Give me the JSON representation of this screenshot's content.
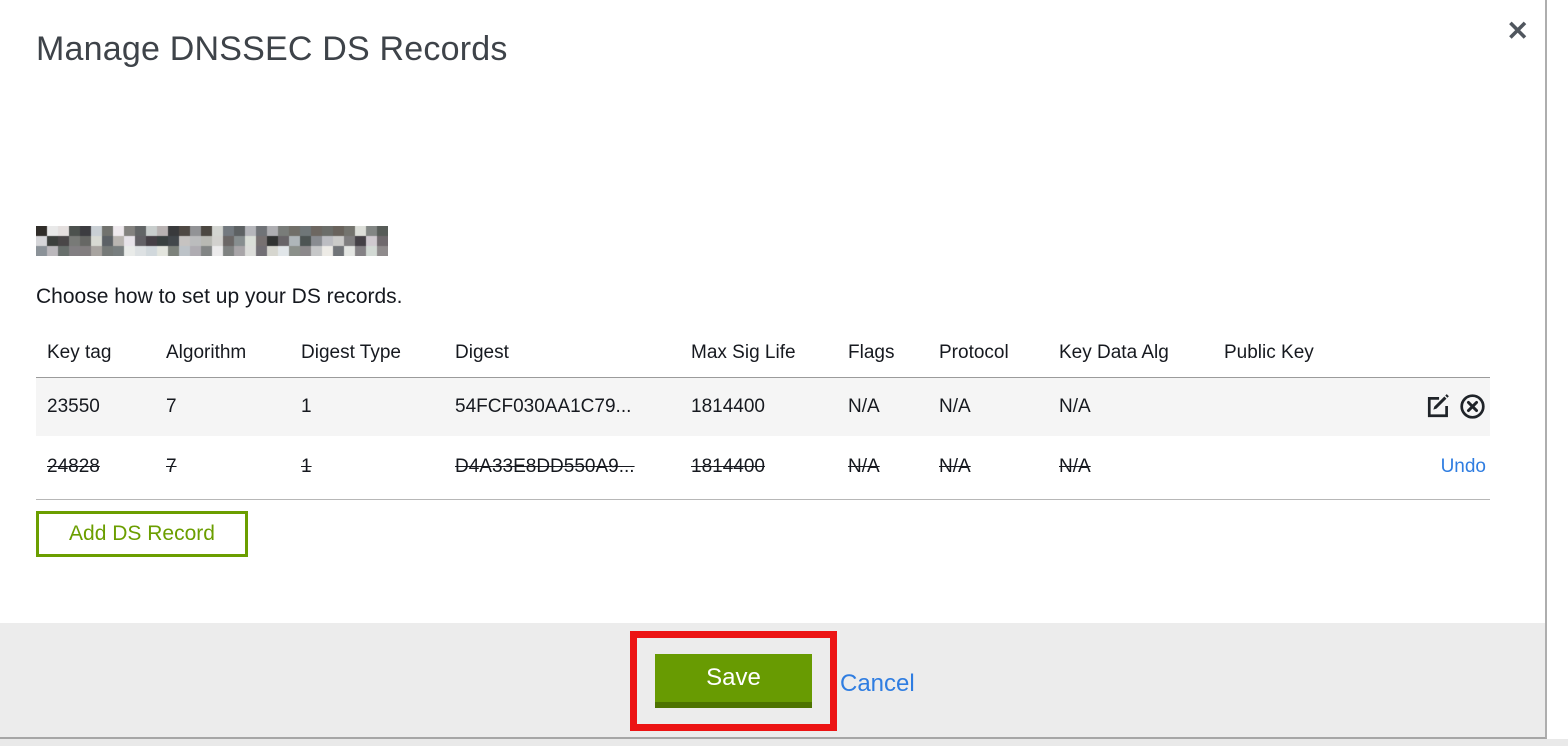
{
  "modal": {
    "title": "Manage DNSSEC DS Records",
    "close_glyph": "✕",
    "instruction": "Choose how to set up your DS records.",
    "add_button_label": "Add DS Record",
    "save_button_label": "Save",
    "cancel_label": "Cancel",
    "undo_label": "Undo"
  },
  "table": {
    "columns": [
      "Key tag",
      "Algorithm",
      "Digest Type",
      "Digest",
      "Max Sig Life",
      "Flags",
      "Protocol",
      "Key Data Alg",
      "Public Key"
    ],
    "rows": [
      {
        "key_tag": "23550",
        "algorithm": "7",
        "digest_type": "1",
        "digest": "54FCF030AA1C79...",
        "max_sig_life": "1814400",
        "flags": "N/A",
        "protocol": "N/A",
        "key_data_alg": "N/A",
        "public_key": "",
        "state": "normal"
      },
      {
        "key_tag": "24828",
        "algorithm": "7",
        "digest_type": "1",
        "digest": "D4A33E8DD550A9...",
        "max_sig_life": "1814400",
        "flags": "N/A",
        "protocol": "N/A",
        "key_data_alg": "N/A",
        "public_key": "",
        "state": "deleted"
      }
    ]
  },
  "icons": {
    "close": "x-mark",
    "edit": "pencil-in-square",
    "remove": "x-in-circle"
  },
  "colors": {
    "accent_green": "#689b02",
    "green_dark": "#4d7300",
    "outline_green": "#6b9e00",
    "link_blue": "#2f7de1",
    "annotation_red": "#ec1414",
    "footer_gray": "#ececec",
    "row_gray": "#f5f5f5",
    "text_dark": "#16191f"
  }
}
